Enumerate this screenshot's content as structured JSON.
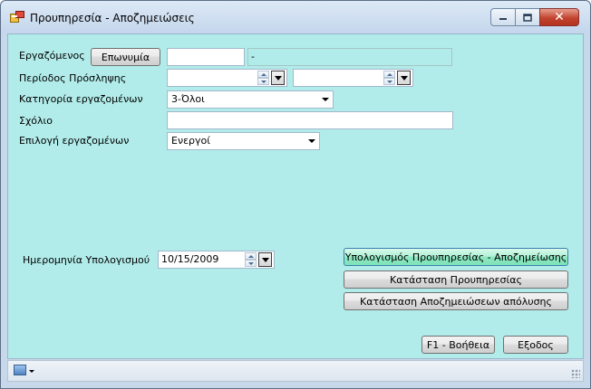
{
  "window": {
    "title": "Προυπηρεσία - Αποζημειώσεις",
    "icons": {
      "app": "app-window-icon",
      "minimize": "minimize-icon",
      "maximize": "maximize-icon",
      "close": "close-icon"
    },
    "close_glyph": "✕"
  },
  "form": {
    "employee": {
      "label": "Εργαζόμενος",
      "name_button": "Επωνυμία",
      "id_value": "",
      "name_value": "-"
    },
    "hiring_period": {
      "label": "Περίοδος Πρόσληψης",
      "from_value": "",
      "to_value": ""
    },
    "category": {
      "label": "Κατηγορία εργαζομένων",
      "selected": "3-Όλοι"
    },
    "comment": {
      "label": "Σχόλιο",
      "value": ""
    },
    "employee_select": {
      "label": "Επιλογή εργαζομένων",
      "selected": "Ενεργοί"
    },
    "calc_date": {
      "label": "Ημερομηνία Υπολογισμού",
      "value": "10/15/2009"
    }
  },
  "actions": {
    "calc_button": "Υπολογισμός Προυπηρεσίας - Αποζημείωσης",
    "service_report_button": "Κατάσταση Προυπηρεσίας",
    "compensation_report_button": "Κατάσταση Αποζημειώσεων απόλυσης",
    "help_button": "F1 - Βοήθεια",
    "exit_button": "Εξοδος"
  },
  "statusbar": {
    "icon": "image-dropdown-icon"
  },
  "colors": {
    "client_background": "#b1ecea",
    "focused_button": "#8fe8c3",
    "window_frame": "#c7d8ea"
  }
}
